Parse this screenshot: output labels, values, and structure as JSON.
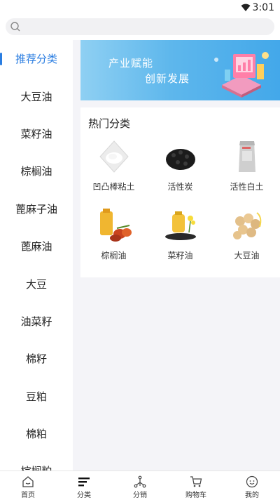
{
  "status_bar": {
    "time": "3:01"
  },
  "search": {
    "placeholder": ""
  },
  "sidebar": {
    "items": [
      {
        "label": "推荐分类",
        "active": true
      },
      {
        "label": "大豆油"
      },
      {
        "label": "菜籽油"
      },
      {
        "label": "棕榈油"
      },
      {
        "label": "蓖麻子油"
      },
      {
        "label": "蓖麻油"
      },
      {
        "label": "大豆"
      },
      {
        "label": "油菜籽"
      },
      {
        "label": "棉籽"
      },
      {
        "label": "豆粕"
      },
      {
        "label": "棉粕"
      },
      {
        "label": "棕榈粕"
      }
    ]
  },
  "banner": {
    "line1": "产业赋能",
    "line2": "创新发展"
  },
  "hot": {
    "title": "热门分类",
    "items": [
      {
        "label": "凹凸棒粘土",
        "icon": "clay-powder-icon"
      },
      {
        "label": "活性炭",
        "icon": "activated-carbon-icon"
      },
      {
        "label": "活性白土",
        "icon": "bleaching-earth-bag-icon"
      },
      {
        "label": "棕榈油",
        "icon": "palm-oil-icon"
      },
      {
        "label": "菜籽油",
        "icon": "rapeseed-oil-icon"
      },
      {
        "label": "大豆油",
        "icon": "soybean-icon"
      }
    ]
  },
  "bottom_nav": {
    "items": [
      {
        "label": "首页",
        "icon": "home-icon"
      },
      {
        "label": "分类",
        "icon": "category-icon",
        "active": true
      },
      {
        "label": "分销",
        "icon": "distribution-icon"
      },
      {
        "label": "购物车",
        "icon": "cart-icon"
      },
      {
        "label": "我的",
        "icon": "profile-icon"
      }
    ]
  },
  "colors": {
    "accent": "#2a7de1",
    "panel_bg": "#f4f4f8"
  }
}
